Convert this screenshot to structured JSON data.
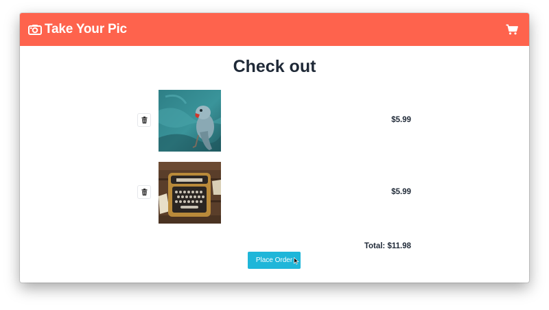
{
  "app": {
    "brand_title": "Take Your Pic",
    "brand_icon": "camera-icon",
    "cart_icon": "cart-icon",
    "header_color": "#fe634d"
  },
  "page": {
    "title": "Check out"
  },
  "cart_items": [
    {
      "image": "parrot-photo",
      "price": "$5.99",
      "delete_icon": "trash-icon"
    },
    {
      "image": "typewriter-photo",
      "price": "$5.99",
      "delete_icon": "trash-icon"
    }
  ],
  "summary": {
    "total_text": "Total: $11.98",
    "place_order_label": "Place Order",
    "button_color": "#1fb6d9"
  }
}
